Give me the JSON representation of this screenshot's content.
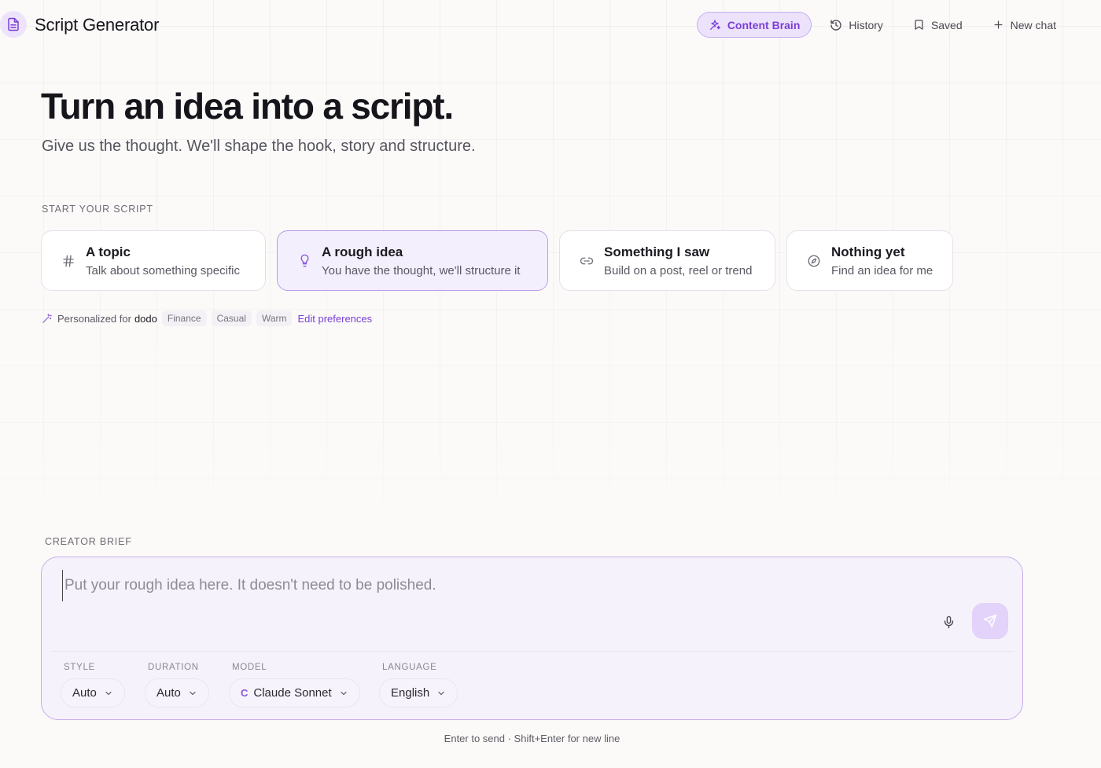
{
  "header": {
    "app_title": "Script Generator",
    "nav": {
      "content_brain": "Content Brain",
      "history": "History",
      "saved": "Saved",
      "new_chat": "New chat"
    }
  },
  "hero": {
    "title": "Turn an idea into a script.",
    "subtitle": "Give us the thought. We'll shape the hook, story and structure."
  },
  "start": {
    "label": "START YOUR SCRIPT",
    "cards": [
      {
        "title": "A topic",
        "desc": "Talk about something specific",
        "icon": "hash-icon"
      },
      {
        "title": "A rough idea",
        "desc": "You have the thought, we'll structure it",
        "icon": "lightbulb-icon",
        "selected": true
      },
      {
        "title": "Something I saw",
        "desc": "Build on a post, reel or trend",
        "icon": "link-icon"
      },
      {
        "title": "Nothing yet",
        "desc": "Find an idea for me",
        "icon": "compass-icon"
      }
    ]
  },
  "personalized": {
    "label": "Personalized for",
    "user": "dodo",
    "tags": [
      "Finance",
      "Casual",
      "Warm"
    ],
    "edit": "Edit preferences"
  },
  "brief": {
    "label": "CREATOR BRIEF",
    "placeholder": "Put your rough idea here. It doesn't need to be polished.",
    "value": "",
    "options": {
      "style": {
        "label": "STYLE",
        "value": "Auto"
      },
      "duration": {
        "label": "DURATION",
        "value": "Auto"
      },
      "model": {
        "label": "MODEL",
        "value": "Claude Sonnet",
        "mark": "C"
      },
      "language": {
        "label": "LANGUAGE",
        "value": "English"
      }
    }
  },
  "hint": "Enter to send · Shift+Enter for new line",
  "colors": {
    "accent": "#7b3fd6",
    "accent_soft": "#ece2fb",
    "background": "#fbfaf8"
  }
}
